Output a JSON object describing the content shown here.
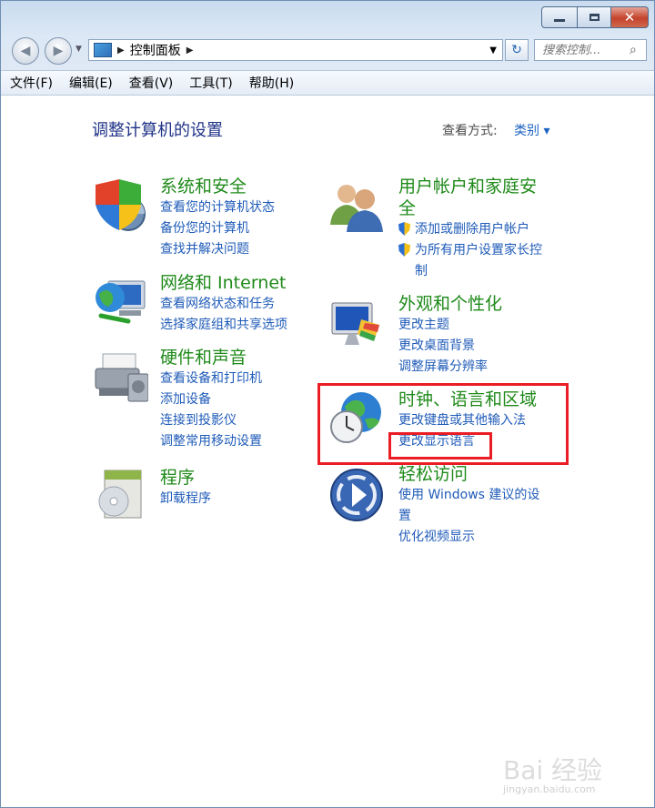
{
  "window": {
    "controls": {
      "minimize": "minimize",
      "maximize": "maximize",
      "close": "close"
    }
  },
  "nav": {
    "address": "控制面板",
    "search_placeholder": "搜索控制..."
  },
  "menu": [
    "文件(F)",
    "编辑(E)",
    "查看(V)",
    "工具(T)",
    "帮助(H)"
  ],
  "main": {
    "heading": "调整计算机的设置",
    "view_by_label": "查看方式:",
    "view_by_value": "类别 ▾"
  },
  "categories": [
    {
      "title": "系统和安全",
      "links": [
        "查看您的计算机状态",
        "备份您的计算机",
        "查找并解决问题"
      ],
      "icon": "security-shield-icon"
    },
    {
      "title": "网络和 Internet",
      "links": [
        "查看网络状态和任务",
        "选择家庭组和共享选项"
      ],
      "icon": "network-globe-icon"
    },
    {
      "title": "硬件和声音",
      "links": [
        "查看设备和打印机",
        "添加设备",
        "连接到投影仪",
        "调整常用移动设置"
      ],
      "icon": "printer-icon"
    },
    {
      "title": "程序",
      "links": [
        "卸载程序"
      ],
      "icon": "programs-disc-icon"
    },
    {
      "title_lines": [
        "用户帐户和家庭安",
        "全"
      ],
      "links": [
        "添加或删除用户帐户",
        "为所有用户设置家长控",
        "制"
      ],
      "icon": "users-icon"
    },
    {
      "title": "外观和个性化",
      "links": [
        "更改主题",
        "更改桌面背景",
        "调整屏幕分辨率"
      ],
      "icon": "monitor-palette-icon"
    },
    {
      "title": "时钟、语言和区域",
      "links": [
        "更改键盘或其他输入法",
        "更改显示语言"
      ],
      "icon": "clock-globe-icon"
    },
    {
      "title": "轻松访问",
      "links": [
        "使用 Windows 建议的设",
        "置",
        "优化视频显示"
      ],
      "icon": "accessibility-icon"
    }
  ],
  "watermark": {
    "text": "Bai 经验",
    "url": "jingyan.baidu.com"
  },
  "colors": {
    "title_green": "#1f8a1a",
    "link_blue": "#1f5bb8",
    "heading_blue": "#1e3287",
    "highlight_red": "#ea1c24"
  }
}
